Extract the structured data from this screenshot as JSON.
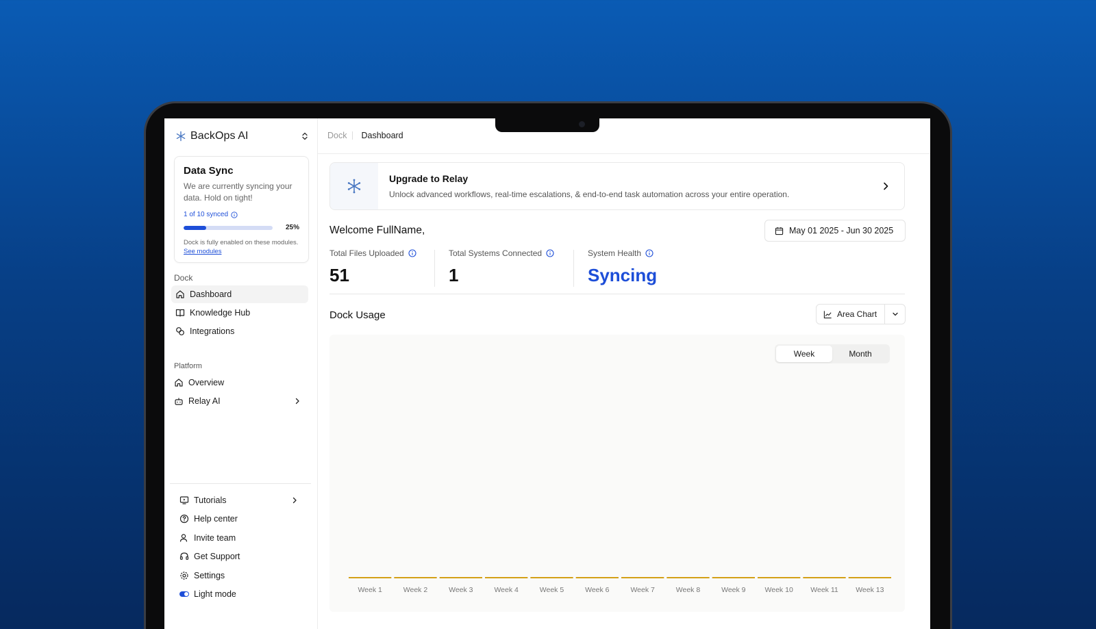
{
  "brand": {
    "name": "BackOps AI"
  },
  "sync_card": {
    "title": "Data Sync",
    "description": "We are currently syncing your data. Hold on tight!",
    "synced_count": "1 of 10 synced",
    "progress_percent": 25,
    "progress_label": "25%",
    "note": "Dock is fully enabled on these modules.",
    "note_link": "See modules"
  },
  "sidebar": {
    "section_dock": "Dock",
    "dock_items": [
      {
        "label": "Dashboard",
        "icon": "home-icon"
      },
      {
        "label": "Knowledge Hub",
        "icon": "book-icon"
      },
      {
        "label": "Integrations",
        "icon": "link-icon"
      }
    ],
    "section_platform": "Platform",
    "platform_items": [
      {
        "label": "Overview",
        "icon": "home-icon"
      },
      {
        "label": "Relay AI",
        "icon": "bot-icon"
      }
    ],
    "bottom_items": [
      {
        "label": "Tutorials",
        "icon": "monitor-play-icon"
      },
      {
        "label": "Help center",
        "icon": "help-circle-icon"
      },
      {
        "label": "Invite team",
        "icon": "user-plus-icon"
      },
      {
        "label": "Get Support",
        "icon": "headset-icon"
      },
      {
        "label": "Settings",
        "icon": "gear-icon"
      },
      {
        "label": "Light mode",
        "icon": "toggle-icon"
      }
    ]
  },
  "breadcrumb": {
    "parent": "Dock",
    "current": "Dashboard"
  },
  "upgrade": {
    "title": "Upgrade to Relay",
    "description": "Unlock advanced workflows, real-time escalations, & end-to-end task automation across your entire operation."
  },
  "welcome": "Welcome FullName,",
  "date_range": "May 01 2025 - Jun 30 2025",
  "stats": [
    {
      "label": "Total Files Uploaded",
      "value": "51"
    },
    {
      "label": "Total Systems Connected",
      "value": "1"
    },
    {
      "label": "System Health",
      "value": "Syncing"
    }
  ],
  "usage": {
    "title": "Dock Usage",
    "chart_type_label": "Area Chart",
    "periods": [
      "Week",
      "Month"
    ],
    "active_period": "Week"
  },
  "colors": {
    "accent": "#1d4ed8",
    "series": "#d4a017"
  },
  "chart_data": {
    "type": "area",
    "categories": [
      "Week 1",
      "Week 2",
      "Week 3",
      "Week 4",
      "Week 5",
      "Week 6",
      "Week 7",
      "Week 8",
      "Week 9",
      "Week 10",
      "Week 11",
      "Week 13"
    ],
    "values": [
      0,
      0,
      0,
      0,
      0,
      0,
      0,
      0,
      0,
      0,
      0,
      0
    ],
    "title": "",
    "xlabel": "",
    "ylabel": "",
    "grid": false
  }
}
